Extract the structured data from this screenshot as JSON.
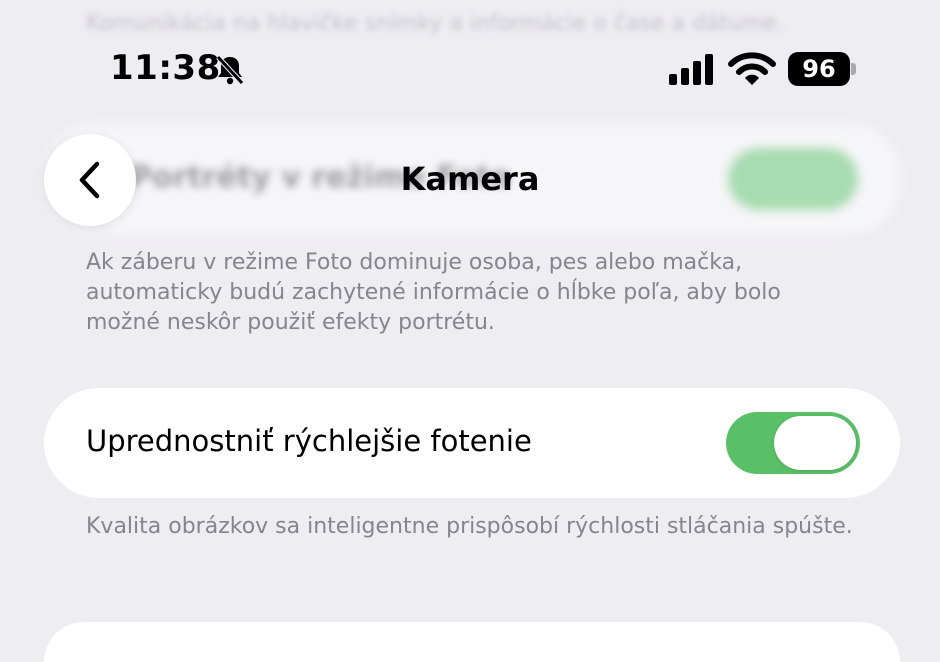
{
  "status_bar": {
    "time": "11:38",
    "battery": "96",
    "icons": [
      "bell-slash-icon",
      "cellular-signal-icon",
      "wifi-icon",
      "battery-icon"
    ]
  },
  "faded_top": {
    "text": "Komunikácia na hlavičke snímky a informácie o čase a dátume."
  },
  "nav": {
    "title": "Kamera",
    "back_icon": "chevron-left-icon",
    "under_label": "Portréty v režime Foto"
  },
  "portrait_footnote": "Ak záberu v režime Foto dominuje osoba, pes alebo mačka, automaticky budú zachytené informácie o hĺbke poľa, aby bolo možné neskôr použiť efekty portrétu.",
  "faster_shooting": {
    "label": "Uprednostniť rýchlejšie fotenie",
    "enabled": true,
    "footnote": "Kvalita obrázkov sa inteligentne prispôsobí rýchlosti stláčania spúšte."
  },
  "colors": {
    "background": "#eeedf2",
    "card": "#ffffff",
    "toggle_on": "#5ac067",
    "footnote_text": "#86858b"
  }
}
